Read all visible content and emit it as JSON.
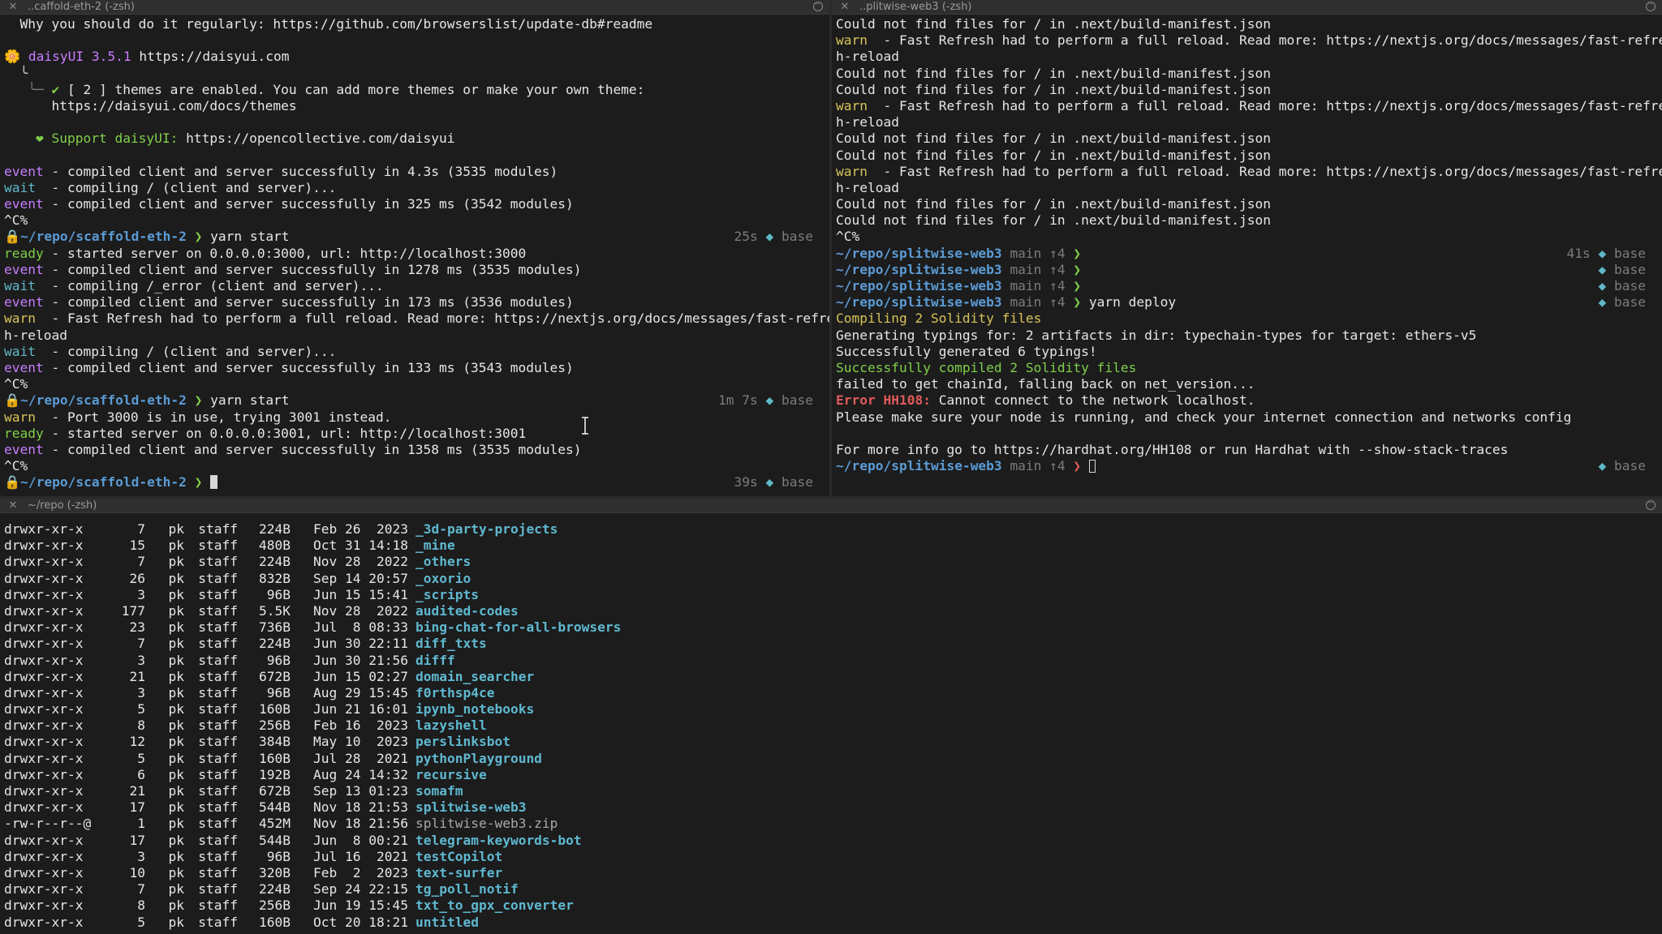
{
  "panes": {
    "left": {
      "title": "..caffold-eth-2 (-zsh)"
    },
    "right": {
      "title": "..plitwise-web3 (-zsh)"
    },
    "bottom": {
      "title": "~/repo (-zsh)"
    }
  },
  "left_lines": [
    {
      "segs": [
        [
          "  Why you should do it regularly: https://github.com/browserslist/update-db#readme",
          "c-white"
        ]
      ]
    },
    {
      "segs": [
        [
          "",
          ""
        ]
      ]
    },
    {
      "segs": [
        [
          "🌼 ",
          ""
        ],
        [
          "daisyUI 3.5.1",
          "c-purple"
        ],
        [
          " https://daisyui.com",
          "c-white"
        ]
      ]
    },
    {
      "segs": [
        [
          "  ╰",
          ""
        ]
      ]
    },
    {
      "segs": [
        [
          "   ╰─ ",
          "c-dim"
        ],
        [
          "✔ ",
          "c-green"
        ],
        [
          "[ 2 ] themes are enabled. You can add more themes or make your own theme:",
          "c-white"
        ]
      ]
    },
    {
      "segs": [
        [
          "      https://daisyui.com/docs/themes",
          "c-white"
        ]
      ]
    },
    {
      "segs": [
        [
          "",
          ""
        ]
      ]
    },
    {
      "segs": [
        [
          "    ",
          ""
        ],
        [
          "❤ ",
          "c-green"
        ],
        [
          "Support daisyUI: ",
          "c-green"
        ],
        [
          "https://opencollective.com/daisyui",
          "c-white"
        ]
      ]
    },
    {
      "segs": [
        [
          "",
          ""
        ]
      ]
    },
    {
      "segs": [
        [
          "event",
          "c-purple"
        ],
        [
          " - compiled client and server successfully in 4.3s (3535 modules)",
          "c-white"
        ]
      ]
    },
    {
      "segs": [
        [
          "wait",
          "c-cyan"
        ],
        [
          "  - compiling / (client and server)...",
          "c-white"
        ]
      ]
    },
    {
      "segs": [
        [
          "event",
          "c-purple"
        ],
        [
          " - compiled client and server successfully in 325 ms (3542 modules)",
          "c-white"
        ]
      ]
    },
    {
      "segs": [
        [
          "^C%",
          "c-white"
        ]
      ]
    },
    {
      "prompt": true,
      "path": "scaffold-eth-2",
      "cmd": "yarn start",
      "time": "25s",
      "env": "base"
    },
    {
      "segs": [
        [
          "ready",
          "c-green"
        ],
        [
          " - started server on 0.0.0.0:3000, url: http://localhost:3000",
          "c-white"
        ]
      ]
    },
    {
      "segs": [
        [
          "event",
          "c-purple"
        ],
        [
          " - compiled client and server successfully in 1278 ms (3535 modules)",
          "c-white"
        ]
      ]
    },
    {
      "segs": [
        [
          "wait",
          "c-cyan"
        ],
        [
          "  - compiling /_error (client and server)...",
          "c-white"
        ]
      ]
    },
    {
      "segs": [
        [
          "event",
          "c-purple"
        ],
        [
          " - compiled client and server successfully in 173 ms (3536 modules)",
          "c-white"
        ]
      ]
    },
    {
      "segs": [
        [
          "warn",
          "c-yellow"
        ],
        [
          "  - Fast Refresh had to perform a full reload. Read more: https://nextjs.org/docs/messages/fast-refres",
          "c-white"
        ]
      ]
    },
    {
      "segs": [
        [
          "h-reload",
          "c-white"
        ]
      ]
    },
    {
      "segs": [
        [
          "wait",
          "c-cyan"
        ],
        [
          "  - compiling / (client and server)...",
          "c-white"
        ]
      ]
    },
    {
      "segs": [
        [
          "event",
          "c-purple"
        ],
        [
          " - compiled client and server successfully in 133 ms (3543 modules)",
          "c-white"
        ]
      ]
    },
    {
      "segs": [
        [
          "^C%",
          "c-white"
        ]
      ]
    },
    {
      "prompt": true,
      "path": "scaffold-eth-2",
      "cmd": "yarn start",
      "time": "1m 7s",
      "env": "base"
    },
    {
      "segs": [
        [
          "warn",
          "c-yellow"
        ],
        [
          "  - Port 3000 is in use, trying 3001 instead.",
          "c-white"
        ]
      ]
    },
    {
      "segs": [
        [
          "ready",
          "c-green"
        ],
        [
          " - started server on 0.0.0.0:3001, url: http://localhost:3001",
          "c-white"
        ]
      ]
    },
    {
      "segs": [
        [
          "event",
          "c-purple"
        ],
        [
          " - compiled client and server successfully in 1358 ms (3535 modules)",
          "c-white"
        ]
      ]
    },
    {
      "segs": [
        [
          "^C%",
          "c-white"
        ]
      ]
    },
    {
      "prompt": true,
      "path": "scaffold-eth-2",
      "cmd": "",
      "time": "39s",
      "env": "base",
      "cursor": "block"
    }
  ],
  "right_lines": [
    {
      "segs": [
        [
          "Could not find files for / in .next/build-manifest.json",
          "c-white"
        ]
      ]
    },
    {
      "segs": [
        [
          "warn",
          "c-yellow"
        ],
        [
          "  - Fast Refresh had to perform a full reload. Read more: https://nextjs.org/docs/messages/fast-refres",
          "c-white"
        ]
      ]
    },
    {
      "segs": [
        [
          "h-reload",
          "c-white"
        ]
      ]
    },
    {
      "segs": [
        [
          "Could not find files for / in .next/build-manifest.json",
          "c-white"
        ]
      ]
    },
    {
      "segs": [
        [
          "Could not find files for / in .next/build-manifest.json",
          "c-white"
        ]
      ]
    },
    {
      "segs": [
        [
          "warn",
          "c-yellow"
        ],
        [
          "  - Fast Refresh had to perform a full reload. Read more: https://nextjs.org/docs/messages/fast-refres",
          "c-white"
        ]
      ]
    },
    {
      "segs": [
        [
          "h-reload",
          "c-white"
        ]
      ]
    },
    {
      "segs": [
        [
          "Could not find files for / in .next/build-manifest.json",
          "c-white"
        ]
      ]
    },
    {
      "segs": [
        [
          "Could not find files for / in .next/build-manifest.json",
          "c-white"
        ]
      ]
    },
    {
      "segs": [
        [
          "warn",
          "c-yellow"
        ],
        [
          "  - Fast Refresh had to perform a full reload. Read more: https://nextjs.org/docs/messages/fast-refres",
          "c-white"
        ]
      ]
    },
    {
      "segs": [
        [
          "h-reload",
          "c-white"
        ]
      ]
    },
    {
      "segs": [
        [
          "Could not find files for / in .next/build-manifest.json",
          "c-white"
        ]
      ]
    },
    {
      "segs": [
        [
          "Could not find files for / in .next/build-manifest.json",
          "c-white"
        ]
      ]
    },
    {
      "segs": [
        [
          "^C%",
          "c-white"
        ]
      ]
    },
    {
      "prompt": true,
      "nolock": true,
      "path": "splitwise-web3",
      "branch": "main ↑4",
      "cmd": "",
      "time": "41s",
      "env": "base"
    },
    {
      "prompt": true,
      "nolock": true,
      "path": "splitwise-web3",
      "branch": "main ↑4",
      "cmd": "",
      "time": "",
      "env": "base"
    },
    {
      "prompt": true,
      "nolock": true,
      "path": "splitwise-web3",
      "branch": "main ↑4",
      "cmd": "",
      "time": "",
      "env": "base"
    },
    {
      "prompt": true,
      "nolock": true,
      "path": "splitwise-web3",
      "branch": "main ↑4",
      "cmd": "yarn deploy",
      "time": "",
      "env": "base"
    },
    {
      "segs": [
        [
          "Compiling 2 Solidity files",
          "c-yellow"
        ]
      ]
    },
    {
      "segs": [
        [
          "Generating typings for: 2 artifacts in dir: typechain-types for target: ethers-v5",
          "c-white"
        ]
      ]
    },
    {
      "segs": [
        [
          "Successfully generated 6 typings!",
          "c-white"
        ]
      ]
    },
    {
      "segs": [
        [
          "Successfully compiled 2 Solidity files",
          "c-green"
        ]
      ]
    },
    {
      "segs": [
        [
          "failed to get chainId, falling back on net_version...",
          "c-white"
        ]
      ]
    },
    {
      "segs": [
        [
          "Error HH108:",
          "c-red"
        ],
        [
          " Cannot connect to the network localhost.",
          "c-white"
        ]
      ]
    },
    {
      "segs": [
        [
          "Please make sure your node is running, and check your internet connection and networks config",
          "c-white"
        ]
      ]
    },
    {
      "segs": [
        [
          "",
          ""
        ]
      ]
    },
    {
      "segs": [
        [
          "For more info go to https://hardhat.org/HH108 or run Hardhat with --show-stack-traces",
          "c-white"
        ]
      ]
    },
    {
      "prompt": true,
      "nolock": true,
      "path": "splitwise-web3",
      "branch": "main ↑4",
      "cmd": "",
      "time": "",
      "env": "base",
      "cursor": "hollow",
      "errprompt": true
    }
  ],
  "ls_rows": [
    [
      "drwxr-xr-x",
      "7",
      "pk",
      "staff",
      "224B",
      "Feb 26  2023",
      "_3d-party-projects",
      "dir"
    ],
    [
      "drwxr-xr-x",
      "15",
      "pk",
      "staff",
      "480B",
      "Oct 31 14:18",
      "_mine",
      "dir"
    ],
    [
      "drwxr-xr-x",
      "7",
      "pk",
      "staff",
      "224B",
      "Nov 28  2022",
      "_others",
      "dir"
    ],
    [
      "drwxr-xr-x",
      "26",
      "pk",
      "staff",
      "832B",
      "Sep 14 20:57",
      "_oxorio",
      "dir"
    ],
    [
      "drwxr-xr-x",
      "3",
      "pk",
      "staff",
      "96B",
      "Jun 15 15:41",
      "_scripts",
      "dir"
    ],
    [
      "drwxr-xr-x",
      "177",
      "pk",
      "staff",
      "5.5K",
      "Nov 28  2022",
      "audited-codes",
      "dir"
    ],
    [
      "drwxr-xr-x",
      "23",
      "pk",
      "staff",
      "736B",
      "Jul  8 08:33",
      "bing-chat-for-all-browsers",
      "dir"
    ],
    [
      "drwxr-xr-x",
      "7",
      "pk",
      "staff",
      "224B",
      "Jun 30 22:11",
      "diff_txts",
      "dir"
    ],
    [
      "drwxr-xr-x",
      "3",
      "pk",
      "staff",
      "96B",
      "Jun 30 21:56",
      "difff",
      "dir"
    ],
    [
      "drwxr-xr-x",
      "21",
      "pk",
      "staff",
      "672B",
      "Jun 15 02:27",
      "domain_searcher",
      "dir"
    ],
    [
      "drwxr-xr-x",
      "3",
      "pk",
      "staff",
      "96B",
      "Aug 29 15:45",
      "f0rthsp4ce",
      "dir"
    ],
    [
      "drwxr-xr-x",
      "5",
      "pk",
      "staff",
      "160B",
      "Jun 21 16:01",
      "ipynb_notebooks",
      "dir"
    ],
    [
      "drwxr-xr-x",
      "8",
      "pk",
      "staff",
      "256B",
      "Feb 16  2023",
      "lazyshell",
      "dir"
    ],
    [
      "drwxr-xr-x",
      "12",
      "pk",
      "staff",
      "384B",
      "May 10  2023",
      "perslinksbot",
      "dir"
    ],
    [
      "drwxr-xr-x",
      "5",
      "pk",
      "staff",
      "160B",
      "Jul 28  2021",
      "pythonPlayground",
      "dir"
    ],
    [
      "drwxr-xr-x",
      "6",
      "pk",
      "staff",
      "192B",
      "Aug 24 14:32",
      "recursive",
      "dir"
    ],
    [
      "drwxr-xr-x",
      "21",
      "pk",
      "staff",
      "672B",
      "Sep 13 01:23",
      "somafm",
      "dir"
    ],
    [
      "drwxr-xr-x",
      "17",
      "pk",
      "staff",
      "544B",
      "Nov 18 21:53",
      "splitwise-web3",
      "dir"
    ],
    [
      "-rw-r--r--@",
      "1",
      "pk",
      "staff",
      "452M",
      "Nov 18 21:56",
      "splitwise-web3.zip",
      "file"
    ],
    [
      "drwxr-xr-x",
      "17",
      "pk",
      "staff",
      "544B",
      "Jun  8 00:21",
      "telegram-keywords-bot",
      "dir"
    ],
    [
      "drwxr-xr-x",
      "3",
      "pk",
      "staff",
      "96B",
      "Jul 16  2021",
      "testCopilot",
      "dir"
    ],
    [
      "drwxr-xr-x",
      "10",
      "pk",
      "staff",
      "320B",
      "Feb  2  2023",
      "text-surfer",
      "dir"
    ],
    [
      "drwxr-xr-x",
      "7",
      "pk",
      "staff",
      "224B",
      "Sep 24 22:15",
      "tg_poll_notif",
      "dir"
    ],
    [
      "drwxr-xr-x",
      "8",
      "pk",
      "staff",
      "256B",
      "Jun 19 15:45",
      "txt_to_gpx_converter",
      "dir"
    ],
    [
      "drwxr-xr-x",
      "5",
      "pk",
      "staff",
      "160B",
      "Oct 20 18:21",
      "untitled",
      "dir"
    ]
  ],
  "prompt_prefix": "~/repo/",
  "prompt_arrow": "❯",
  "env_glyph": "◆",
  "lock_glyph": "🔒"
}
